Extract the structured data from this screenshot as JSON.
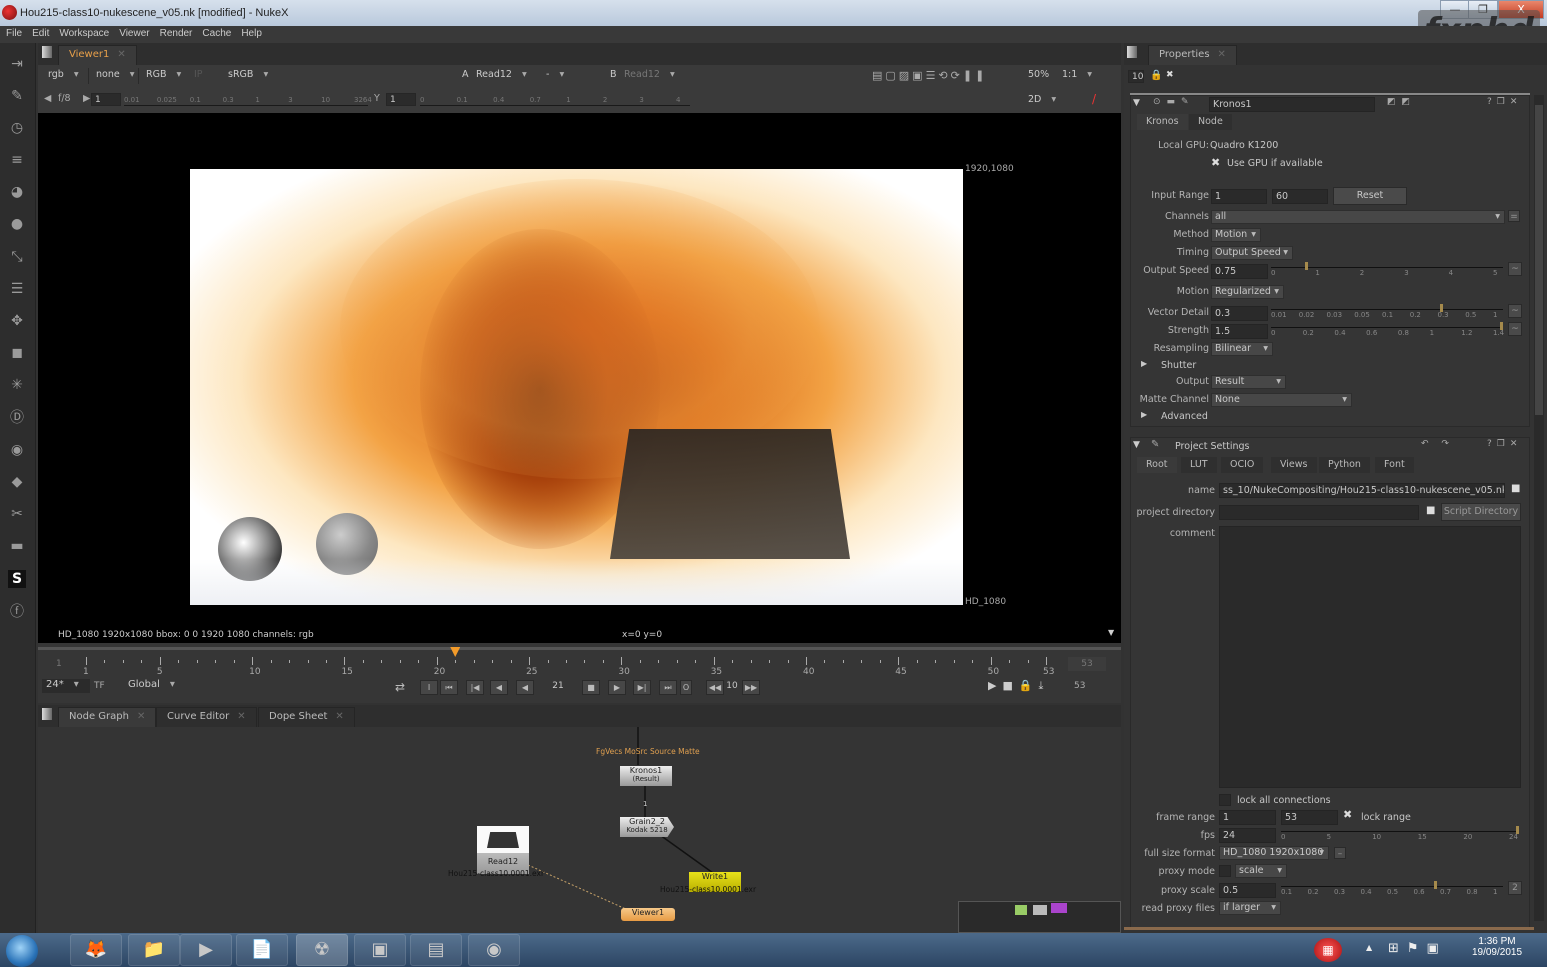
{
  "window": {
    "title": "Hou215-class10-nukescene_v05.nk [modified] - NukeX",
    "controls": {
      "minimize": "—",
      "maximize": "❐",
      "close": "X"
    },
    "watermark": "fxphd"
  },
  "menubar": [
    "File",
    "Edit",
    "Workspace",
    "Viewer",
    "Render",
    "Cache",
    "Help"
  ],
  "left_toolbar": [
    "image-icon",
    "draw-icon",
    "time-icon",
    "channel-icon",
    "color-icon",
    "filter-icon",
    "keyer-icon",
    "merge-icon",
    "transform-icon",
    "3d-icon",
    "particles-icon",
    "deep-icon",
    "views-icon",
    "metadata-icon",
    "toolsets-icon",
    "other-icon",
    "smartvector-icon",
    "furnace-icon"
  ],
  "viewer": {
    "tab": "Viewer1",
    "channels": "rgb",
    "alpha_channel": "none",
    "display_channels": "RGB",
    "ip": "IP",
    "lut": "sRGB",
    "input_a_label": "A",
    "input_a": "Read12",
    "wipe_mode": "-",
    "input_b_label": "B",
    "input_b": "Read12",
    "zoom": "50%",
    "proxy_ratio": "1:1",
    "view_mode": "2D",
    "fstop": "f/8",
    "gain": "1",
    "gain_ticks": [
      "0.01",
      "0.025",
      "0.1",
      "0.3",
      "1",
      "3",
      "10",
      "3264"
    ],
    "gamma_label": "Y",
    "gamma": "1",
    "gamma_ticks": [
      "0",
      "0.1",
      "0.4",
      "0.7",
      "1",
      "2",
      "3",
      "4"
    ],
    "format_corner": "1920,1080",
    "format_label": "HD_1080",
    "info": "HD_1080 1920x1080  bbox: 0 0 1920 1080 channels: rgb",
    "coords": "x=0 y=0"
  },
  "timeline": {
    "start": "1",
    "end": "53",
    "current_frame": "21",
    "labels": [
      "1",
      "5",
      "10",
      "15",
      "20",
      "25",
      "30",
      "35",
      "40",
      "45",
      "50",
      "53"
    ],
    "fps": "24*",
    "tf": "TF",
    "range_mode": "Global",
    "increment": "10",
    "end_frame_field": "53",
    "range_end_field": "53"
  },
  "bottom_tabs": [
    {
      "label": "Node Graph",
      "active": true
    },
    {
      "label": "Curve Editor",
      "active": false
    },
    {
      "label": "Dope Sheet",
      "active": false
    }
  ],
  "nodes": {
    "kronos": {
      "name": "Kronos1",
      "sub": "(Result)",
      "inputs": [
        "FgVecs",
        "MoSrc",
        "Source",
        "Matte"
      ]
    },
    "grain": {
      "name": "Grain2_2",
      "sub": "Kodak 5218"
    },
    "read": {
      "name": "Read12",
      "file": "Hou215-class10.0001.exr"
    },
    "write": {
      "name": "Write1",
      "file": "Hou215-class10.0001.exr"
    },
    "viewer": {
      "name": "Viewer1"
    },
    "link_label": "1"
  },
  "properties": {
    "tab": "Properties",
    "max_panels": "10",
    "kronos": {
      "name": "Kronos1",
      "tabs": [
        "Kronos",
        "Node"
      ],
      "local_gpu_label": "Local GPU:",
      "local_gpu": "Quadro K1200",
      "use_gpu": "Use GPU if available",
      "input_range_label": "Input Range",
      "input_range_start": "1",
      "input_range_end": "60",
      "reset": "Reset",
      "channels_label": "Channels",
      "channels": "all",
      "method_label": "Method",
      "method": "Motion",
      "timing_label": "Timing",
      "timing": "Output Speed",
      "output_speed_label": "Output Speed",
      "output_speed": "0.75",
      "output_speed_ticks": [
        "0",
        "1",
        "2",
        "3",
        "4",
        "5"
      ],
      "output_speed_fraction": 0.15,
      "motion_label": "Motion",
      "motion": "Regularized",
      "vector_detail_label": "Vector Detail",
      "vector_detail": "0.3",
      "vector_detail_ticks": [
        "0.01",
        "0.02",
        "0.03",
        "0.05",
        "0.1",
        "0.2",
        "0.3",
        "0.5",
        "1"
      ],
      "vector_detail_fraction": 0.74,
      "strength_label": "Strength",
      "strength": "1.5",
      "strength_ticks": [
        "0",
        "0.2",
        "0.4",
        "0.6",
        "0.8",
        "1",
        "1.2",
        "1.4"
      ],
      "strength_fraction": 1.0,
      "resampling_label": "Resampling",
      "resampling": "Bilinear",
      "shutter": "Shutter",
      "output_label": "Output",
      "output": "Result",
      "matte_label": "Matte Channel",
      "matte": "None",
      "advanced": "Advanced"
    },
    "project": {
      "title": "Project Settings",
      "tabs": [
        "Root",
        "LUT",
        "OCIO",
        "Views",
        "Python",
        "Font"
      ],
      "name_label": "name",
      "name": "ss_10/NukeCompositing/Hou215-class10-nukescene_v05.nk",
      "project_dir_label": "project directory",
      "project_dir": "",
      "script_dir": "Script Directory",
      "comment_label": "comment",
      "comment": "",
      "lock_connections": "lock all connections",
      "frame_range_label": "frame range",
      "frame_start": "1",
      "frame_end": "53",
      "lock_range": "lock range",
      "fps_label": "fps",
      "fps": "24",
      "fps_ticks": [
        "0",
        "5",
        "10",
        "15",
        "20",
        "24"
      ],
      "fps_fraction": 1.0,
      "format_label": "full size format",
      "format": "HD_1080 1920x1080",
      "proxy_mode_label": "proxy mode",
      "proxy_mode": "scale",
      "proxy_scale_label": "proxy scale",
      "proxy_scale": "0.5",
      "proxy_scale_ticks": [
        "0.1",
        "0.2",
        "0.3",
        "0.4",
        "0.5",
        "0.6",
        "0.7",
        "0.8",
        "1"
      ],
      "proxy_scale_fraction": 0.7,
      "proxy_button": "2",
      "read_proxy_label": "read proxy files",
      "read_proxy": "if larger"
    }
  },
  "taskbar": {
    "apps": [
      "windows-start",
      "firefox",
      "explorer",
      "media-player",
      "notepad",
      "nuke",
      "excel-like",
      "office",
      "excel-record"
    ],
    "time": "1:36 PM",
    "date": "19/09/2015"
  }
}
